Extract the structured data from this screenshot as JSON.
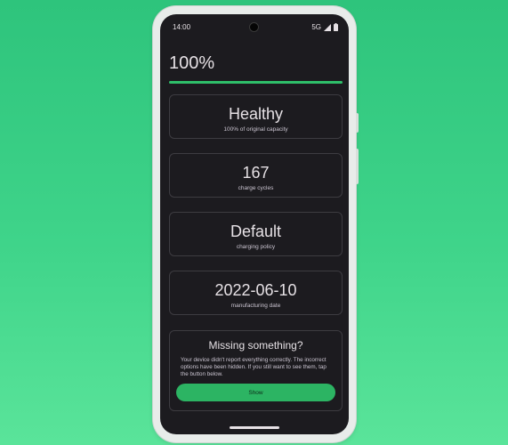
{
  "status_bar": {
    "time": "14:00",
    "network": "5G",
    "icons": [
      "signal-icon",
      "battery-icon"
    ]
  },
  "battery": {
    "percent_label": "100%",
    "level": 1.0
  },
  "cards": {
    "health": {
      "value": "Healthy",
      "label": "100% of original capacity"
    },
    "cycles": {
      "value": "167",
      "label": "charge cycles"
    },
    "policy": {
      "value": "Default",
      "label": "charging policy"
    },
    "manufacturing": {
      "value": "2022-06-10",
      "label": "manufacturing date"
    }
  },
  "missing": {
    "title": "Missing something?",
    "text": "Your device didn't report everything correctly. The incorrect options have been hidden. If you still want to see them, tap the button below.",
    "button_label": "Show"
  },
  "colors": {
    "accent": "#2fbf6a",
    "background": "#1c1b1f"
  }
}
